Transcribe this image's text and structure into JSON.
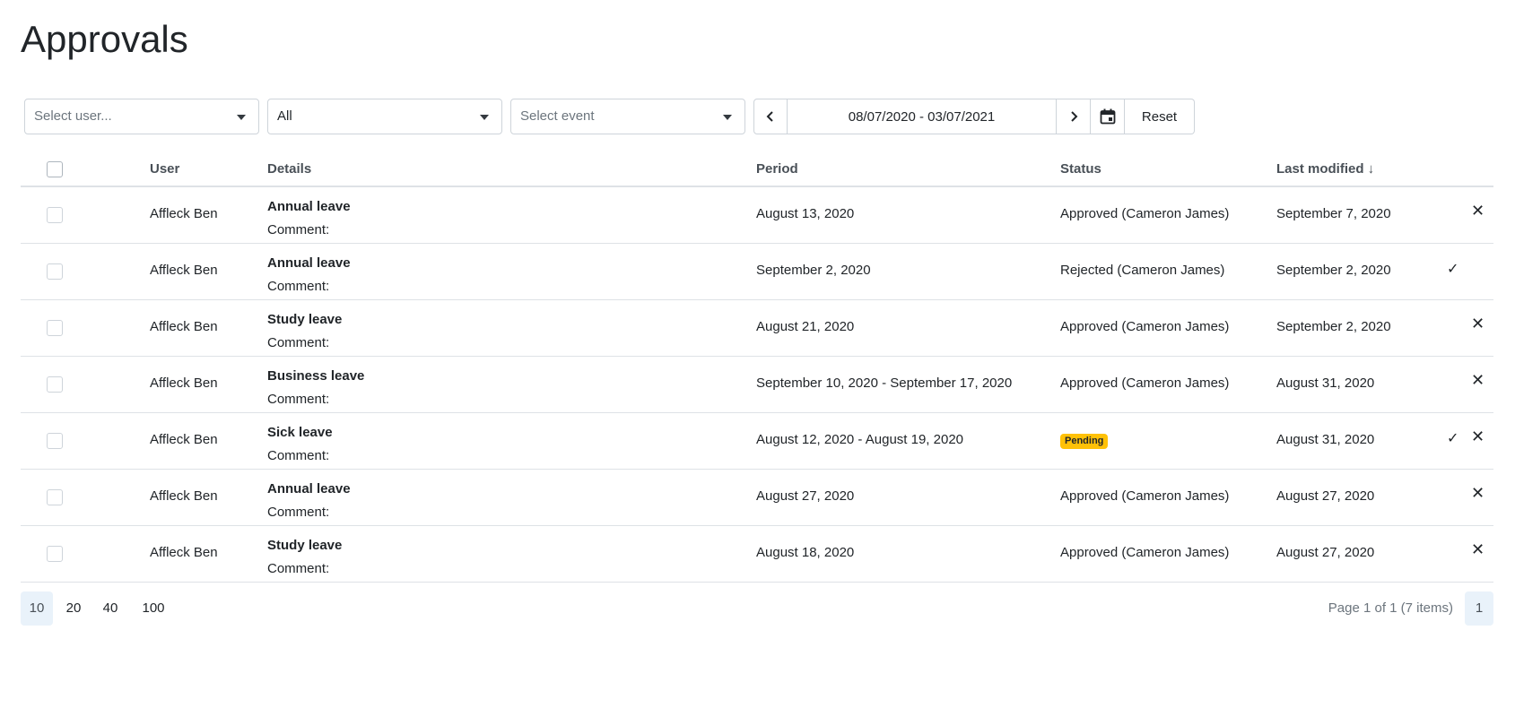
{
  "page": {
    "title": "Approvals"
  },
  "filters": {
    "user": {
      "placeholder": "Select user..."
    },
    "type": {
      "value": "All"
    },
    "event": {
      "placeholder": "Select event"
    },
    "date_range": "08/07/2020 - 03/07/2021",
    "reset_label": "Reset"
  },
  "table": {
    "headers": {
      "user": "User",
      "details": "Details",
      "period": "Period",
      "status": "Status",
      "last_modified": "Last modified ↓"
    },
    "comment_label": "Comment:",
    "rows": [
      {
        "user": "Affleck Ben",
        "title": "Annual leave",
        "period": "August 13, 2020",
        "status": "Approved (Cameron James)",
        "pending": false,
        "last_modified": "September 7, 2020",
        "actions": [
          "reject"
        ]
      },
      {
        "user": "Affleck Ben",
        "title": "Annual leave",
        "period": "September 2, 2020",
        "status": "Rejected (Cameron James)",
        "pending": false,
        "last_modified": "September 2, 2020",
        "actions": [
          "approve"
        ]
      },
      {
        "user": "Affleck Ben",
        "title": "Study leave",
        "period": "August 21, 2020",
        "status": "Approved (Cameron James)",
        "pending": false,
        "last_modified": "September 2, 2020",
        "actions": [
          "reject"
        ]
      },
      {
        "user": "Affleck Ben",
        "title": "Business leave",
        "period": "September 10, 2020 - September 17, 2020",
        "status": "Approved (Cameron James)",
        "pending": false,
        "last_modified": "August 31, 2020",
        "actions": [
          "reject"
        ]
      },
      {
        "user": "Affleck Ben",
        "title": "Sick leave",
        "period": "August 12, 2020 - August 19, 2020",
        "status": "Pending",
        "pending": true,
        "last_modified": "August 31, 2020",
        "actions": [
          "approve",
          "reject"
        ]
      },
      {
        "user": "Affleck Ben",
        "title": "Annual leave",
        "period": "August 27, 2020",
        "status": "Approved (Cameron James)",
        "pending": false,
        "last_modified": "August 27, 2020",
        "actions": [
          "reject"
        ]
      },
      {
        "user": "Affleck Ben",
        "title": "Study leave",
        "period": "August 18, 2020",
        "status": "Approved (Cameron James)",
        "pending": false,
        "last_modified": "August 27, 2020",
        "actions": [
          "reject"
        ]
      }
    ]
  },
  "pagination": {
    "page_sizes": [
      "10",
      "20",
      "40",
      "100"
    ],
    "active_page_size": "10",
    "info": "Page 1 of 1 (7 items)",
    "current_page": "1"
  },
  "colors": {
    "pending_badge": "#ffc107",
    "active_bg": "#e9f2fa"
  },
  "icons": {
    "approve": "check-icon",
    "reject": "close-icon",
    "prev": "chevron-left-icon",
    "next": "chevron-right-icon",
    "calendar": "calendar-icon",
    "dropdown": "caret-down-icon"
  }
}
